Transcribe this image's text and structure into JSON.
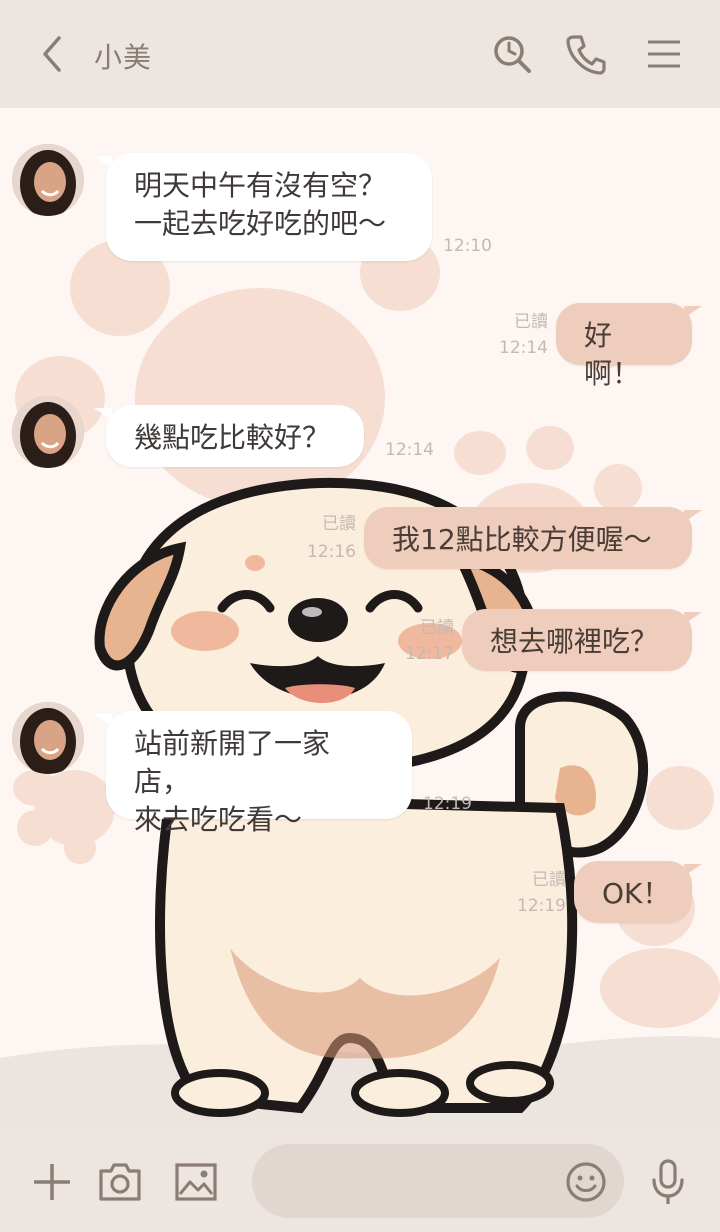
{
  "header": {
    "contact_name": "小美",
    "icons": [
      "back-chevron-icon",
      "search-history-icon",
      "phone-icon",
      "menu-icon"
    ]
  },
  "messages": [
    {
      "from": "them",
      "text": "明天中午有沒有空？\n一起去吃好吃的吧～",
      "time": "12:10"
    },
    {
      "from": "me",
      "text": "好啊！",
      "read": "已讀",
      "time": "12:14"
    },
    {
      "from": "them",
      "text": "幾點吃比較好？",
      "time": "12:14"
    },
    {
      "from": "me",
      "text": "我12點比較方便喔～",
      "read": "已讀",
      "time": "12:16"
    },
    {
      "from": "me",
      "text": "想去哪裡吃？",
      "read": "已讀",
      "time": "12:17"
    },
    {
      "from": "them",
      "text": "站前新開了一家店，\n來去吃吃看～",
      "time": "12:19"
    },
    {
      "from": "me",
      "text": "OK！",
      "read": "已讀",
      "time": "12:19"
    }
  ],
  "footer": {
    "input_value": "",
    "icons": [
      "plus-icon",
      "camera-icon",
      "image-icon",
      "emoji-icon",
      "microphone-icon"
    ]
  },
  "colors": {
    "header_bg": "#ede5df",
    "chat_bg": "#fdf6f3",
    "incoming_bubble": "#ffffff",
    "outgoing_bubble": "#eecdbd",
    "icon": "#8a7d75"
  }
}
